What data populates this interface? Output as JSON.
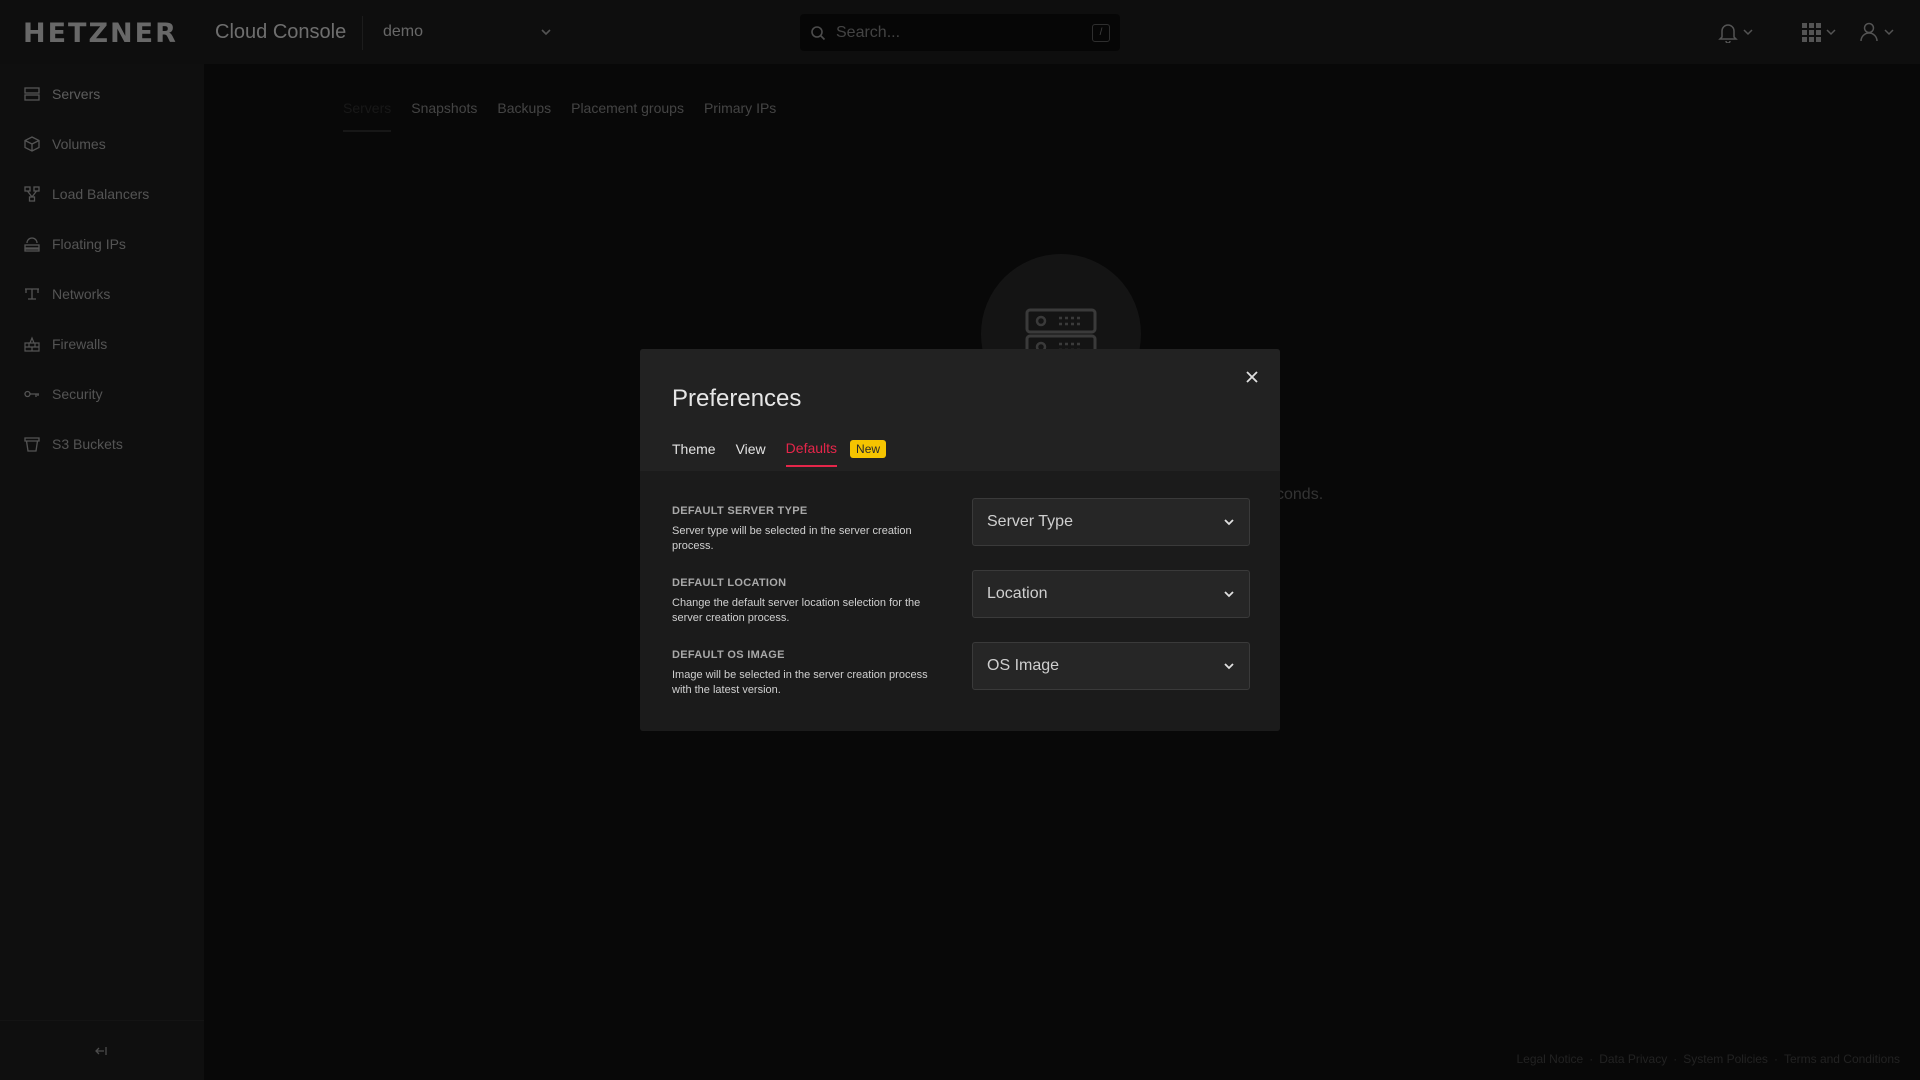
{
  "topbar": {
    "logo": "HETZNER",
    "app_title": "Cloud Console",
    "project": "demo",
    "search_placeholder": "Search...",
    "search_shortcut": "/"
  },
  "sidebar": {
    "items": [
      {
        "label": "Servers",
        "icon": "server-icon"
      },
      {
        "label": "Volumes",
        "icon": "cube-icon"
      },
      {
        "label": "Load Balancers",
        "icon": "load-balancer-icon"
      },
      {
        "label": "Floating IPs",
        "icon": "floating-ip-icon"
      },
      {
        "label": "Networks",
        "icon": "network-icon"
      },
      {
        "label": "Firewalls",
        "icon": "firewall-icon"
      },
      {
        "label": "Security",
        "icon": "key-icon"
      },
      {
        "label": "S3 Buckets",
        "icon": "bucket-icon"
      }
    ]
  },
  "main": {
    "tabs": [
      "Servers",
      "Snapshots",
      "Backups",
      "Placement groups",
      "Primary IPs"
    ],
    "background_text": "conds."
  },
  "modal": {
    "title": "Preferences",
    "tabs": [
      "Theme",
      "View",
      "Defaults"
    ],
    "badge": "New",
    "rows": [
      {
        "label": "DEFAULT SERVER TYPE",
        "description": "Server type will be selected in the server creation process.",
        "select_value": "Server Type"
      },
      {
        "label": "DEFAULT LOCATION",
        "description": "Change the default server location selection for the server creation process.",
        "select_value": "Location"
      },
      {
        "label": "DEFAULT OS IMAGE",
        "description": "Image will be selected in the server creation process with the latest version.",
        "select_value": "OS Image"
      }
    ]
  },
  "footer": {
    "links": [
      "Legal Notice",
      "Data Privacy",
      "System Policies",
      "Terms and Conditions"
    ],
    "separator": "·"
  },
  "colors": {
    "accent": "#e5264a",
    "badge": "#f5c400"
  }
}
